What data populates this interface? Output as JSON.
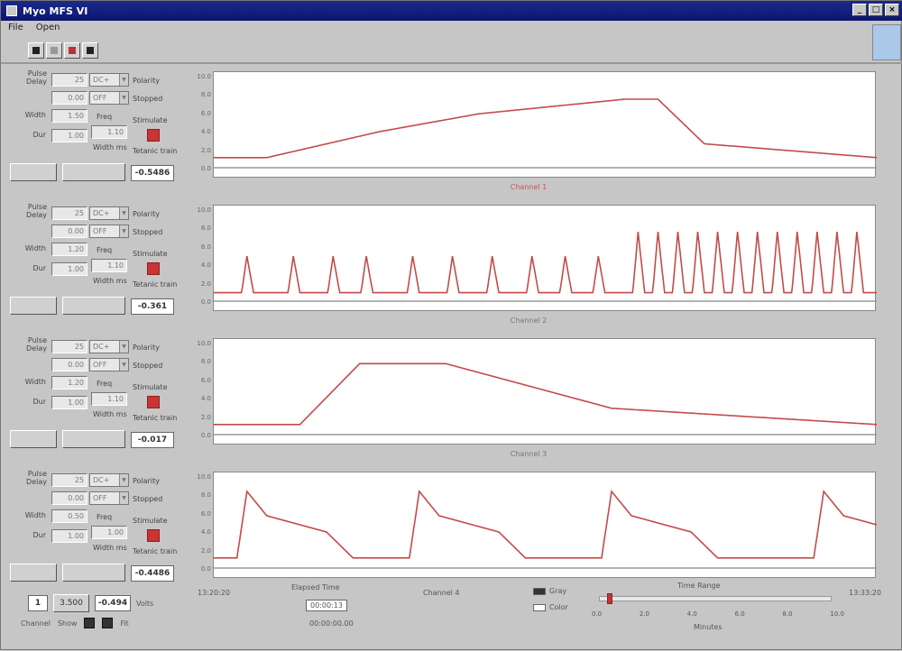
{
  "window": {
    "title": "Myo MFS VI"
  },
  "menu": [
    "File",
    "Open"
  ],
  "channels": [
    {
      "label": "Channel 1",
      "label_color": "#cc5555",
      "value": "-0.5486",
      "delay": "0.00",
      "amp": "25",
      "freq_sel": "DC+",
      "mode_sel": "OFF",
      "width": "1.50",
      "freq": "1.10",
      "dur": "1.00",
      "y_ticks": [
        "10.0",
        "8.0",
        "6.0",
        "4.0",
        "2.0",
        "0.0"
      ]
    },
    {
      "label": "Channel 2",
      "label_color": "#777777",
      "value": "-0.361",
      "delay": "0.00",
      "amp": "25",
      "freq_sel": "DC+",
      "mode_sel": "OFF",
      "width": "1.20",
      "freq": "1.10",
      "dur": "1.00",
      "y_ticks": [
        "10.0",
        "8.0",
        "6.0",
        "4.0",
        "2.0",
        "0.0"
      ]
    },
    {
      "label": "Channel 3",
      "label_color": "#777777",
      "value": "-0.017",
      "delay": "0.00",
      "amp": "25",
      "freq_sel": "DC+",
      "mode_sel": "OFF",
      "width": "1.20",
      "freq": "1.10",
      "dur": "1.00",
      "y_ticks": [
        "10.0",
        "8.0",
        "6.0",
        "4.0",
        "2.0",
        "0.0"
      ]
    },
    {
      "label": "Channel 4",
      "label_color": "#777777",
      "value": "-0.4486",
      "delay": "0.00",
      "amp": "25",
      "freq_sel": "DC+",
      "mode_sel": "OFF",
      "width": "0.50",
      "freq": "1.00",
      "dur": "1.00",
      "y_ticks": [
        "10.0",
        "8.0",
        "6.0",
        "4.0",
        "2.0",
        "0.0"
      ]
    }
  ],
  "panel_labels": {
    "pulse": "Pulse",
    "delay": "Delay",
    "width": "Width",
    "dur": "Dur",
    "polarity": "Polarity",
    "stopped": "Stopped",
    "stimulate": "Stimulate",
    "freq": "Freq",
    "width_ms": "Width ms",
    "tetanic": "Tetanic train"
  },
  "bottom": {
    "left_time": "13:20:20",
    "right_time": "13:33:20",
    "elapsed_label": "Elapsed Time",
    "elapsed_value": "00:00:13",
    "sub_value": "00:00:00.00",
    "channel_display": "Channel 4",
    "gray_label": "Gray",
    "color_label": "Color",
    "timerange_label": "Time Range",
    "minutes_label": "Minutes",
    "ticks": [
      "0.0",
      "2.0",
      "4.0",
      "6.0",
      "8.0",
      "10.0"
    ],
    "slider_fraction": 0.03,
    "ctrl_input": "1",
    "ctrl_a": "3.500",
    "ctrl_b": "-0.494",
    "ctrl_b_unit": "Volts",
    "channel_label": "Channel",
    "show_label": "Show",
    "fit_label": "Fit"
  },
  "colors": {
    "trace": "#c44a4a",
    "baseline": "#999999"
  }
}
